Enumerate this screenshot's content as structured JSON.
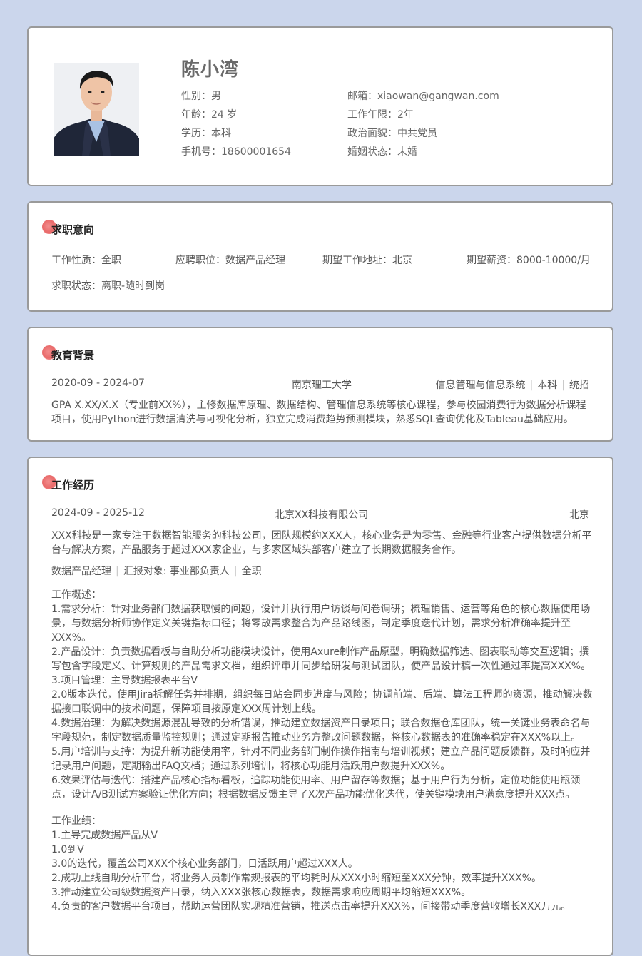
{
  "profile": {
    "name": "陈小湾",
    "left": [
      {
        "label": "性别：",
        "value": "男"
      },
      {
        "label": "年龄：",
        "value": "24 岁"
      },
      {
        "label": "学历：",
        "value": "本科"
      },
      {
        "label": "手机号：",
        "value": "18600001654"
      }
    ],
    "right": [
      {
        "label": "邮箱：",
        "value": "xiaowan@gangwan.com"
      },
      {
        "label": "工作年限：",
        "value": "2年"
      },
      {
        "label": "政治面貌：",
        "value": "中共党员"
      },
      {
        "label": "婚姻状态：",
        "value": "未婚"
      }
    ]
  },
  "intent": {
    "title": "求职意向",
    "items": [
      {
        "label": "工作性质：",
        "value": "全职"
      },
      {
        "label": "应聘职位：",
        "value": "数据产品经理"
      },
      {
        "label": "期望工作地址：",
        "value": "北京"
      },
      {
        "label": "期望薪资：",
        "value": "8000-10000/月"
      },
      {
        "label": "求职状态：",
        "value": "离职-随时到岗"
      }
    ]
  },
  "education": {
    "title": "教育背景",
    "period": "2020-09 - 2024-07",
    "school": "南京理工大学",
    "major": "信息管理与信息系统",
    "degree": "本科",
    "type": "统招",
    "desc": "GPA X.XX/X.X（专业前XX%），主修数据库原理、数据结构、管理信息系统等核心课程，参与校园消费行为数据分析课程项目，使用Python进行数据清洗与可视化分析，独立完成消费趋势预测模块，熟悉SQL查询优化及Tableau基础应用。"
  },
  "work": {
    "title": "工作经历",
    "period": "2024-09 - 2025-12",
    "company": "北京XX科技有限公司",
    "city": "北京",
    "intro": "XXX科技是一家专注于数据智能服务的科技公司，团队规模约XXX人，核心业务是为零售、金融等行业客户提供数据分析平台与解决方案，产品服务于超过XXX家企业，与多家区域头部客户建立了长期数据服务合作。",
    "role": "数据产品经理",
    "report": "汇报对象: 事业部负责人",
    "jobtype": "全职",
    "overview_title": "工作概述：",
    "overview": [
      "1.需求分析：针对业务部门数据获取慢的问题，设计并执行用户访谈与问卷调研；梳理销售、运营等角色的核心数据使用场景，与数据分析师协作定义关键指标口径；将零散需求整合为产品路线图，制定季度迭代计划，需求分析准确率提升至XXX%。",
      "2.产品设计：负责数据看板与自助分析功能模块设计，使用Axure制作产品原型，明确数据筛选、图表联动等交互逻辑；撰写包含字段定义、计算规则的产品需求文档，组织评审并同步给研发与测试团队，使产品设计稿一次性通过率提高XXX%。",
      "3.项目管理：主导数据报表平台V",
      "2.0版本迭代，使用Jira拆解任务并排期，组织每日站会同步进度与风险；协调前端、后端、算法工程师的资源，推动解决数据接口联调中的技术问题，保障项目按原定XXX周计划上线。",
      "4.数据治理：为解决数据源混乱导致的分析错误，推动建立数据资产目录项目；联合数据仓库团队，统一关键业务表命名与字段规范，制定数据质量监控规则；通过定期报告推动业务方整改问题数据，将核心数据表的准确率稳定在XXX%以上。",
      "5.用户培训与支持：为提升新功能使用率，针对不同业务部门制作操作指南与培训视频；建立产品问题反馈群，及时响应并记录用户问题，定期输出FAQ文档；通过系列培训，将核心功能月活跃用户数提升XXX%。",
      "6.效果评估与迭代：搭建产品核心指标看板，追踪功能使用率、用户留存等数据；基于用户行为分析，定位功能使用瓶颈点，设计A/B测试方案验证优化方向；根据数据反馈主导了X次产品功能优化迭代，使关键模块用户满意度提升XXX点。"
    ],
    "achievements_title": "工作业绩：",
    "achievements": [
      "1.主导完成数据产品从V",
      "1.0到V",
      "3.0的迭代，覆盖公司XXX个核心业务部门，日活跃用户超过XXX人。",
      "2.成功上线自助分析平台，将业务人员制作常规报表的平均耗时从XXX小时缩短至XXX分钟，效率提升XXX%。",
      "3.推动建立公司级数据资产目录，纳入XXX张核心数据表，数据需求响应周期平均缩短XXX%。",
      "4.负责的客户数据平台项目，帮助运营团队实现精准营销，推送点击率提升XXX%，间接带动季度营收增长XXX万元。"
    ]
  }
}
